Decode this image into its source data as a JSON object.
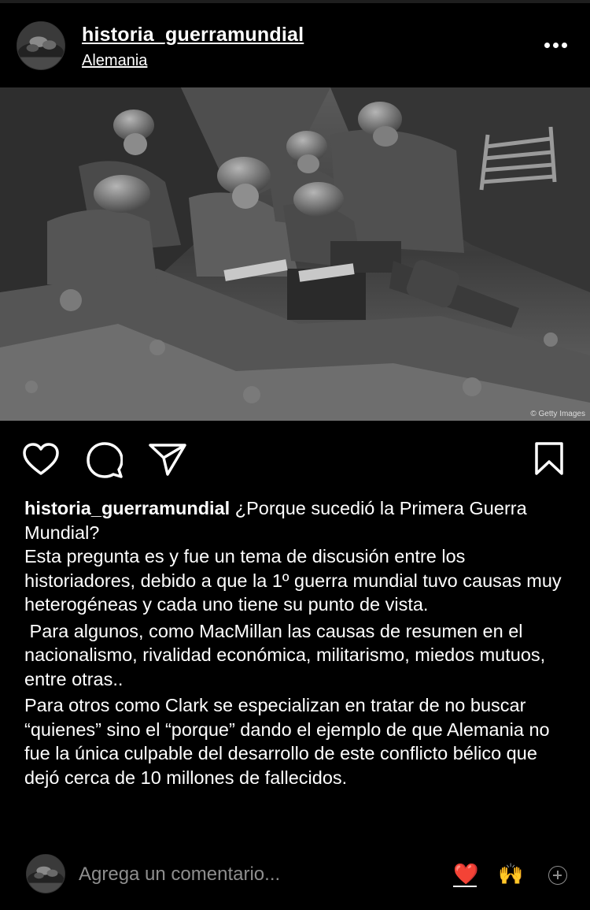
{
  "post": {
    "username": "historia_guerramundial",
    "location": "Alemania",
    "image_credit": "© Getty Images",
    "caption": {
      "username": "historia_guerramundial",
      "first_line": "¿Porque sucedió la Primera Guerra Mundial?",
      "paragraphs": [
        "Esta pregunta es y fue un tema de discusión entre los historiadores, debido a que la 1º guerra mundial tuvo causas muy heterogéneas y cada uno tiene su punto de vista.",
        " Para algunos, como MacMillan las causas de resumen en el nacionalismo, rivalidad económica, militarismo, miedos mutuos, entre otras..",
        "Para otros como Clark se especializan en tratar de no buscar “quienes” sino el “porque” dando el ejemplo de que Alemania no fue la única culpable del desarrollo de este conflicto bélico que dejó cerca de 10 millones de fallecidos."
      ]
    }
  },
  "actions": {
    "like_icon": "heart-outline-icon",
    "comment_icon": "speech-bubble-icon",
    "share_icon": "paper-plane-icon",
    "save_icon": "bookmark-icon"
  },
  "comment_bar": {
    "placeholder": "Agrega un comentario...",
    "quick_emojis": [
      "❤️",
      "🙌"
    ],
    "add_icon": "plus-circle-icon"
  }
}
